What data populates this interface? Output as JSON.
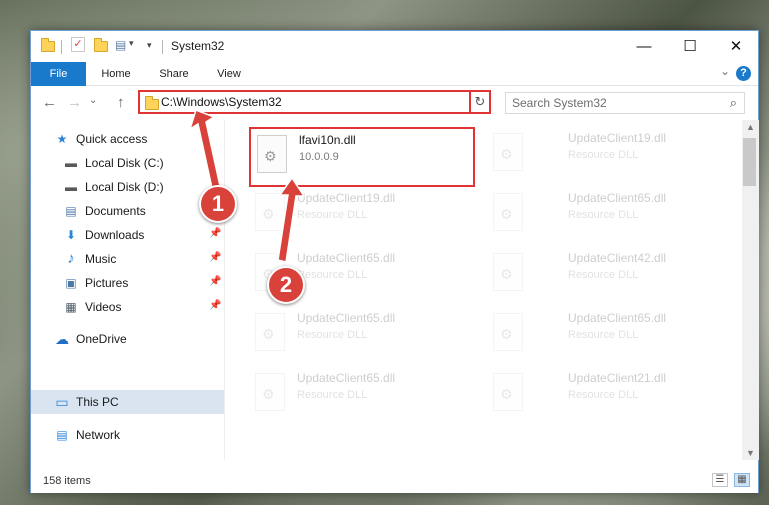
{
  "window": {
    "title": "System32",
    "controls": {
      "minimize": "—",
      "maximize": "☐",
      "close": "✕"
    }
  },
  "ribbon": {
    "tabs": [
      "File",
      "Home",
      "Share",
      "View"
    ],
    "collapse": "⌄",
    "help": "?"
  },
  "nav": {
    "back": "←",
    "forward": "→",
    "recent": "⌄",
    "up": "↑",
    "address": "C:\\Windows\\System32",
    "address_dropdown": "⌄",
    "refresh": "↻",
    "search_placeholder": "Search System32",
    "search_icon": "⌕"
  },
  "sidebar": {
    "items": [
      {
        "label": "Quick access",
        "icon": "star-icon",
        "glyph": "★",
        "color": "#2b84d8",
        "pinned": false
      },
      {
        "label": "Local Disk (C:)",
        "icon": "drive-icon",
        "glyph": "▬",
        "color": "#5a5a5a",
        "pinned": false
      },
      {
        "label": "Local Disk (D:)",
        "icon": "drive-icon",
        "glyph": "▬",
        "color": "#5a5a5a",
        "pinned": false
      },
      {
        "label": "Documents",
        "icon": "documents-icon",
        "glyph": "▤",
        "color": "#4d79a8",
        "pinned": true
      },
      {
        "label": "Downloads",
        "icon": "download-icon",
        "glyph": "⬇",
        "color": "#2b84d8",
        "pinned": true
      },
      {
        "label": "Music",
        "icon": "music-icon",
        "glyph": "♪",
        "color": "#2b84d8",
        "pinned": true
      },
      {
        "label": "Pictures",
        "icon": "pictures-icon",
        "glyph": "▣",
        "color": "#4d79a8",
        "pinned": true
      },
      {
        "label": "Videos",
        "icon": "videos-icon",
        "glyph": "▦",
        "color": "#4d5a6a",
        "pinned": true
      },
      {
        "label": "OneDrive",
        "icon": "cloud-icon",
        "glyph": "☁",
        "color": "#1f6fc5",
        "pinned": false
      },
      {
        "label": "This PC",
        "icon": "computer-icon",
        "glyph": "▭",
        "color": "#2b84d8",
        "pinned": false,
        "selected": true
      },
      {
        "label": "Network",
        "icon": "network-icon",
        "glyph": "▤",
        "color": "#2b84d8",
        "pinned": false
      }
    ],
    "pin_glyph": "📌"
  },
  "files": [
    {
      "name": "lfavi10n.dll",
      "sub": "10.0.0.9",
      "selected": true
    },
    {
      "name": "UpdateClient19.dll",
      "sub": "Resource DLL"
    },
    {
      "name": "UpdateClient19.dll",
      "sub": "Resource DLL"
    },
    {
      "name": "UpdateClient65.dll",
      "sub": "Resource DLL"
    },
    {
      "name": "UpdateClient65.dll",
      "sub": "Resource DLL"
    },
    {
      "name": "UpdateClient42.dll",
      "sub": "Resource DLL"
    },
    {
      "name": "UpdateClient65.dll",
      "sub": "Resource DLL"
    },
    {
      "name": "UpdateClient65.dll",
      "sub": "Resource DLL"
    },
    {
      "name": "UpdateClient65.dll",
      "sub": "Resource DLL"
    },
    {
      "name": "UpdateClient21.dll",
      "sub": "Resource DLL"
    }
  ],
  "status": {
    "count": "158 items"
  },
  "callouts": [
    "1",
    "2"
  ],
  "colors": {
    "accent": "#1979ca",
    "highlight": "#e03434",
    "badge": "#d9413b"
  }
}
